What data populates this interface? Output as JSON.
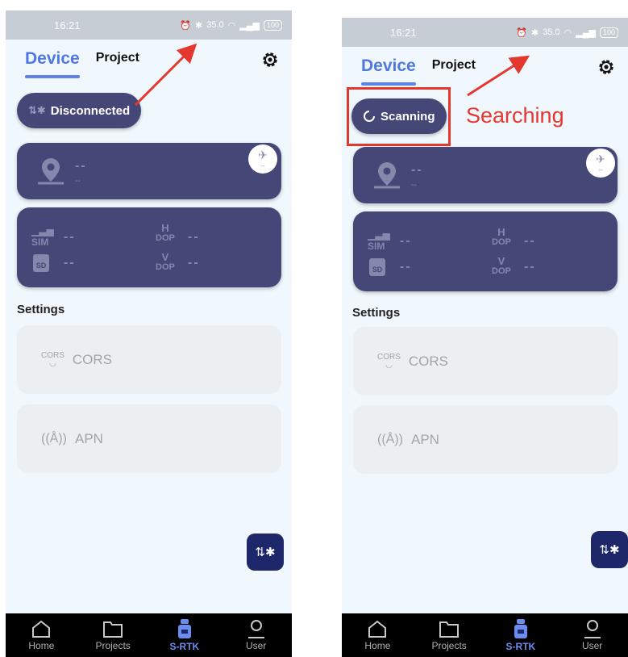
{
  "colors": {
    "accent": "#4f78e0",
    "card": "#454777",
    "fab": "#1d2769",
    "annotation": "#e4382f"
  },
  "left": {
    "status": {
      "time": "16:21",
      "speed": "35.0",
      "battery": "100"
    },
    "tabs": {
      "device": "Device",
      "project": "Project"
    },
    "connection_label": "Disconnected",
    "card1": {
      "value": "--",
      "sub": "--",
      "badge": "--"
    },
    "card2": {
      "sim": "--",
      "sd": "--",
      "hdop_label": [
        "H",
        "DOP"
      ],
      "hdop": "--",
      "vdop_label": [
        "V",
        "DOP"
      ],
      "vdop": "--"
    },
    "settings": {
      "title": "Settings",
      "cors_icon_text": "CORS",
      "cors": "CORS",
      "apn": "APN"
    },
    "nav": [
      "Home",
      "Projects",
      "S-RTK",
      "User"
    ]
  },
  "right": {
    "status": {
      "time": "16:21",
      "speed": "35.0",
      "battery": "100"
    },
    "tabs": {
      "device": "Device",
      "project": "Project"
    },
    "connection_label": "Scanning",
    "card1": {
      "value": "--",
      "sub": "--",
      "badge": "--"
    },
    "card2": {
      "sim": "--",
      "sd": "--",
      "hdop_label": [
        "H",
        "DOP"
      ],
      "hdop": "--",
      "vdop_label": [
        "V",
        "DOP"
      ],
      "vdop": "--"
    },
    "settings": {
      "title": "Settings",
      "cors_icon_text": "CORS",
      "cors": "CORS",
      "apn": "APN"
    },
    "nav": [
      "Home",
      "Projects",
      "S-RTK",
      "User"
    ]
  },
  "annotation": {
    "label": "Searching"
  }
}
